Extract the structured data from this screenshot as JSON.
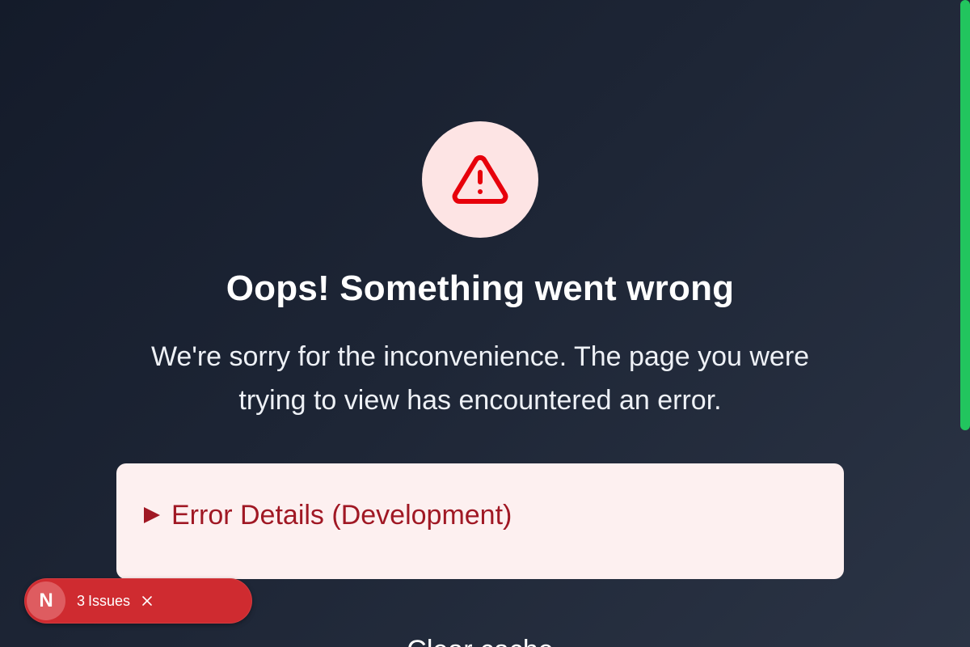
{
  "error_page": {
    "title": "Oops! Something went wrong",
    "message": "We're sorry for the inconvenience. The page you were trying to view has encountered an error.",
    "details_summary": "Error Details (Development)",
    "partial_heading": "Clear cache"
  },
  "dev_overlay": {
    "logo_letter": "N",
    "issues_count": "3",
    "issues_label": "Issues"
  },
  "colors": {
    "accent_error": "#e7000b",
    "icon_bg": "#fde4e4",
    "card_bg": "#fdf0f0",
    "card_text": "#a01824",
    "pill_bg": "#cf2b30",
    "scrollbar": "#22c55e"
  },
  "icons": {
    "warning": "warning-triangle-icon",
    "close": "close-icon"
  }
}
